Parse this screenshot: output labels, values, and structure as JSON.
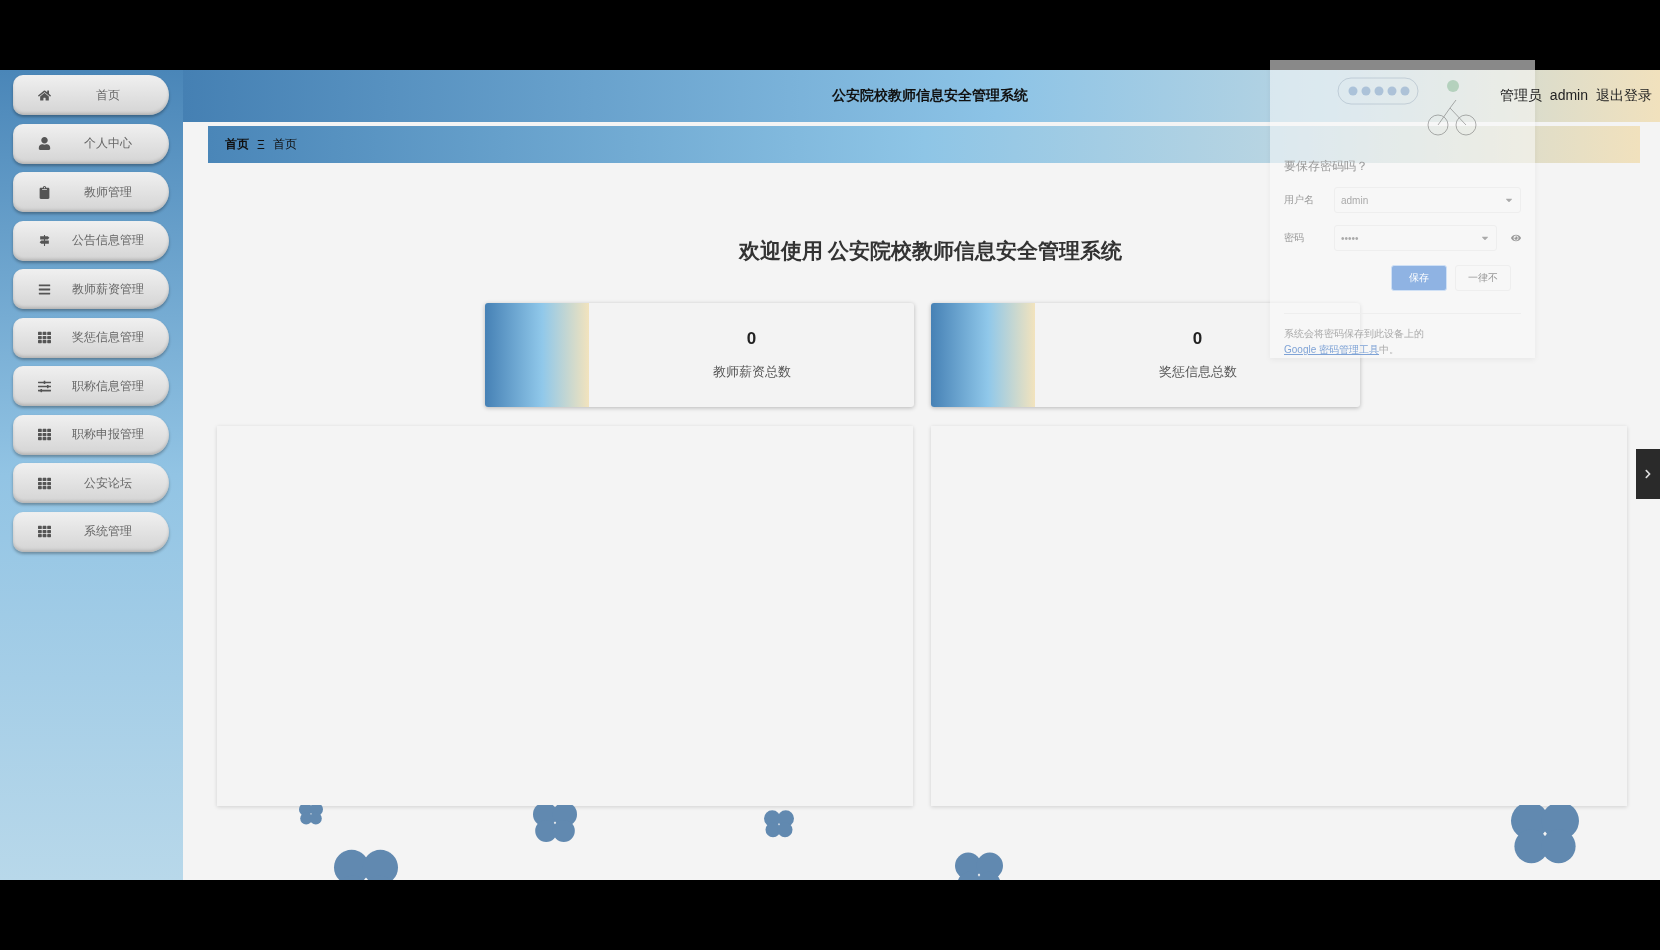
{
  "sidebar": {
    "items": [
      {
        "label": "首页"
      },
      {
        "label": "个人中心"
      },
      {
        "label": "教师管理"
      },
      {
        "label": "公告信息管理"
      },
      {
        "label": "教师薪资管理"
      },
      {
        "label": "奖惩信息管理"
      },
      {
        "label": "职称信息管理"
      },
      {
        "label": "职称申报管理"
      },
      {
        "label": "公安论坛"
      },
      {
        "label": "系统管理"
      }
    ]
  },
  "header": {
    "title": "公安院校教师信息安全管理系统",
    "role": "管理员",
    "user": "admin",
    "logout": "退出登录"
  },
  "breadcrumb": [
    "首页",
    "首页"
  ],
  "breadcrumb_separator": "Ξ",
  "welcome": "欢迎使用 公安院校教师信息安全管理系统",
  "stats": [
    {
      "value": "0",
      "label": "教师薪资总数"
    },
    {
      "value": "0",
      "label": "奖惩信息总数"
    }
  ],
  "password_popup": {
    "title": "要保存密码吗？",
    "username_label": "用户名",
    "username": "admin",
    "password_label": "密码",
    "password": "•••••",
    "save": "保存",
    "never": "一律不",
    "note": "系统会将密码保存到此设备上的",
    "note_link": "Google 密码管理工具",
    "note_end": "中。"
  }
}
